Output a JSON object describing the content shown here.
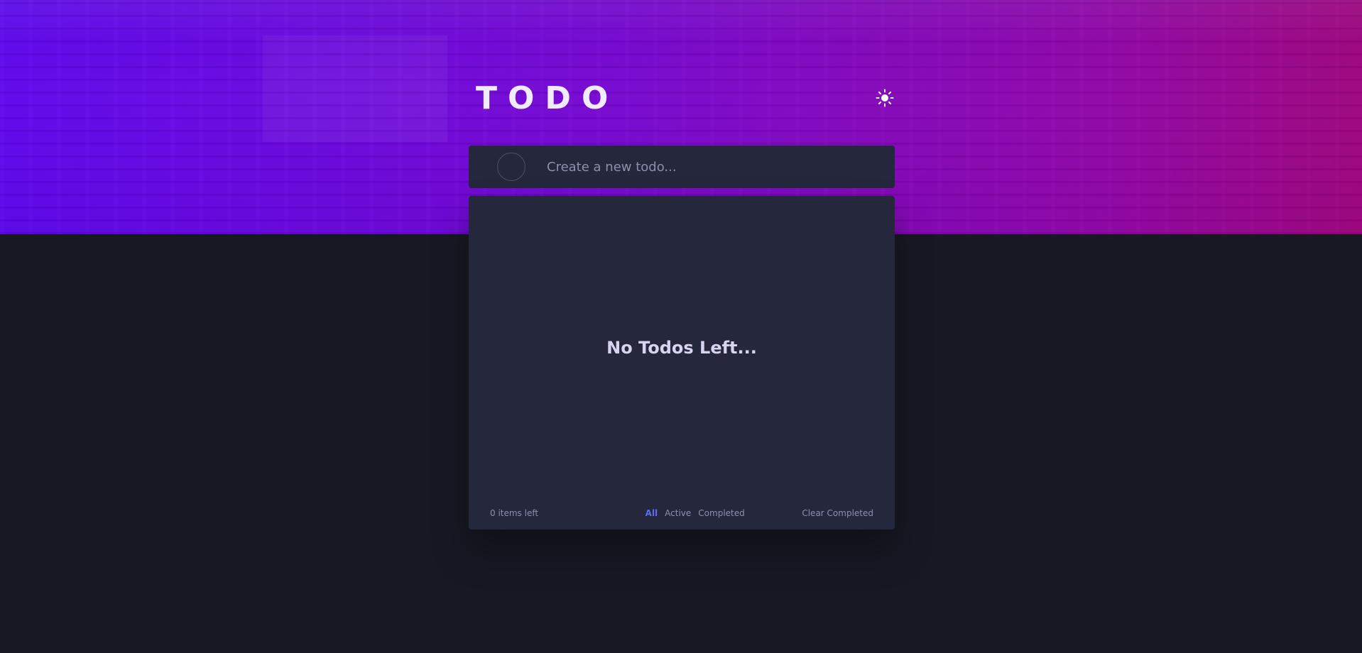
{
  "app": {
    "title": "TODO",
    "theme_toggle_icon": "sun-icon",
    "accent_color": "#5d6df0",
    "card_color": "#25273d",
    "background_color": "#181824"
  },
  "new_todo": {
    "placeholder": "Create a new todo...",
    "value": ""
  },
  "list": {
    "empty_message": "No Todos Left..."
  },
  "footer": {
    "items_left": "0 items left",
    "filters": [
      {
        "label": "All",
        "active": true
      },
      {
        "label": "Active",
        "active": false
      },
      {
        "label": "Completed",
        "active": false
      }
    ],
    "clear_label": "Clear Completed"
  }
}
